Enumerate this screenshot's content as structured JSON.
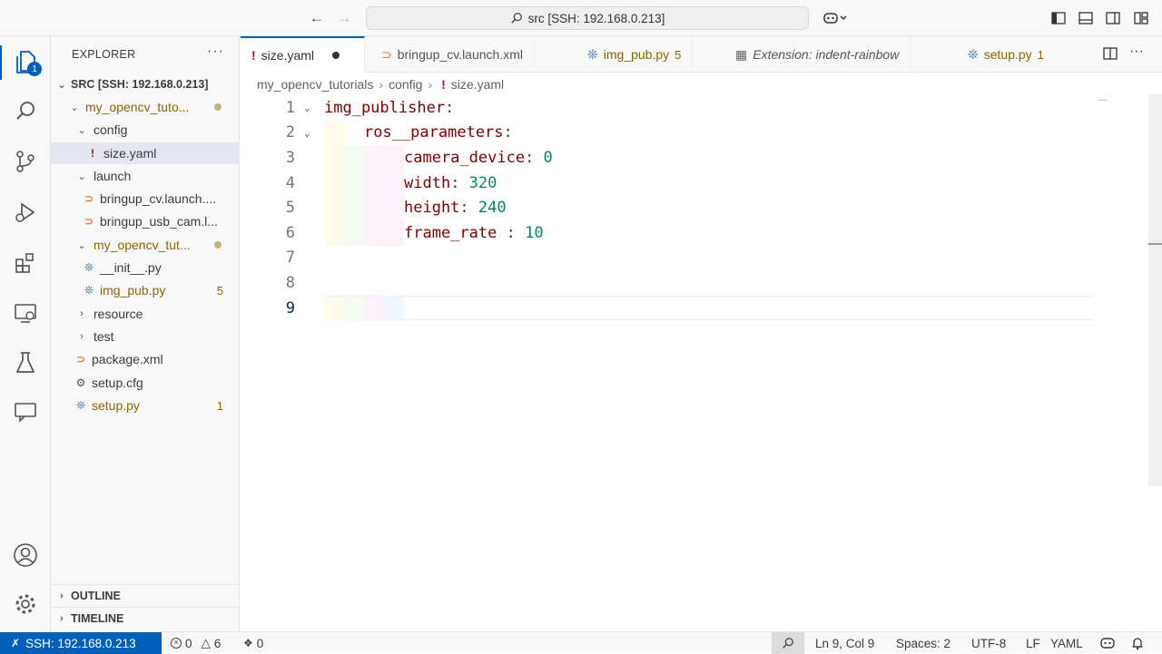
{
  "titlebar": {
    "search_text": "src [SSH: 192.168.0.213]"
  },
  "activity": {
    "explorer_badge": "1"
  },
  "sidebar": {
    "header": "EXPLORER",
    "root": "SRC [SSH: 192.168.0.213]",
    "items": [
      {
        "label": "my_opencv_tuto...",
        "kind": "folder"
      },
      {
        "label": "config",
        "kind": "folder"
      },
      {
        "label": "size.yaml",
        "kind": "yaml"
      },
      {
        "label": "launch",
        "kind": "folder"
      },
      {
        "label": "bringup_cv.launch....",
        "kind": "xml"
      },
      {
        "label": "bringup_usb_cam.l...",
        "kind": "xml"
      },
      {
        "label": "my_opencv_tut...",
        "kind": "folder"
      },
      {
        "label": "__init__.py",
        "kind": "py"
      },
      {
        "label": "img_pub.py",
        "kind": "py",
        "badge": "5"
      },
      {
        "label": "resource",
        "kind": "folder"
      },
      {
        "label": "test",
        "kind": "folder"
      },
      {
        "label": "package.xml",
        "kind": "xml"
      },
      {
        "label": "setup.cfg",
        "kind": "cfg"
      },
      {
        "label": "setup.py",
        "kind": "py",
        "badge": "1"
      }
    ],
    "outline": "OUTLINE",
    "timeline": "TIMELINE"
  },
  "tabs": [
    {
      "label": "size.yaml"
    },
    {
      "label": "bringup_cv.launch.xml"
    },
    {
      "label": "img_pub.py",
      "badge": "5"
    },
    {
      "label": "Extension: indent-rainbow"
    },
    {
      "label": "setup.py",
      "badge": "1"
    }
  ],
  "breadcrumbs": [
    "my_opencv_tutorials",
    "config",
    "size.yaml"
  ],
  "code": {
    "line_numbers": [
      "1",
      "2",
      "3",
      "4",
      "5",
      "6",
      "7",
      "8",
      "9"
    ],
    "l1_key": "img_publisher",
    "l2_key": "ros__parameters",
    "l3_key": "camera_device",
    "l3_val": "0",
    "l4_key": "width",
    "l4_val": "320",
    "l5_key": "height",
    "l5_val": "240",
    "l6_key": "frame_rate",
    "l6_val": "10"
  },
  "status": {
    "remote": "SSH: 192.168.0.213",
    "errors": "0",
    "warnings": "6",
    "ports": "0",
    "position": "Ln 9, Col 9",
    "spaces": "Spaces: 2",
    "encoding": "UTF-8",
    "eol": "LF",
    "language": "YAML"
  },
  "colors": {
    "accent": "#005fb8",
    "yaml_key": "#800000",
    "yaml_number": "#098658",
    "warning_badge": "#8a6500"
  }
}
